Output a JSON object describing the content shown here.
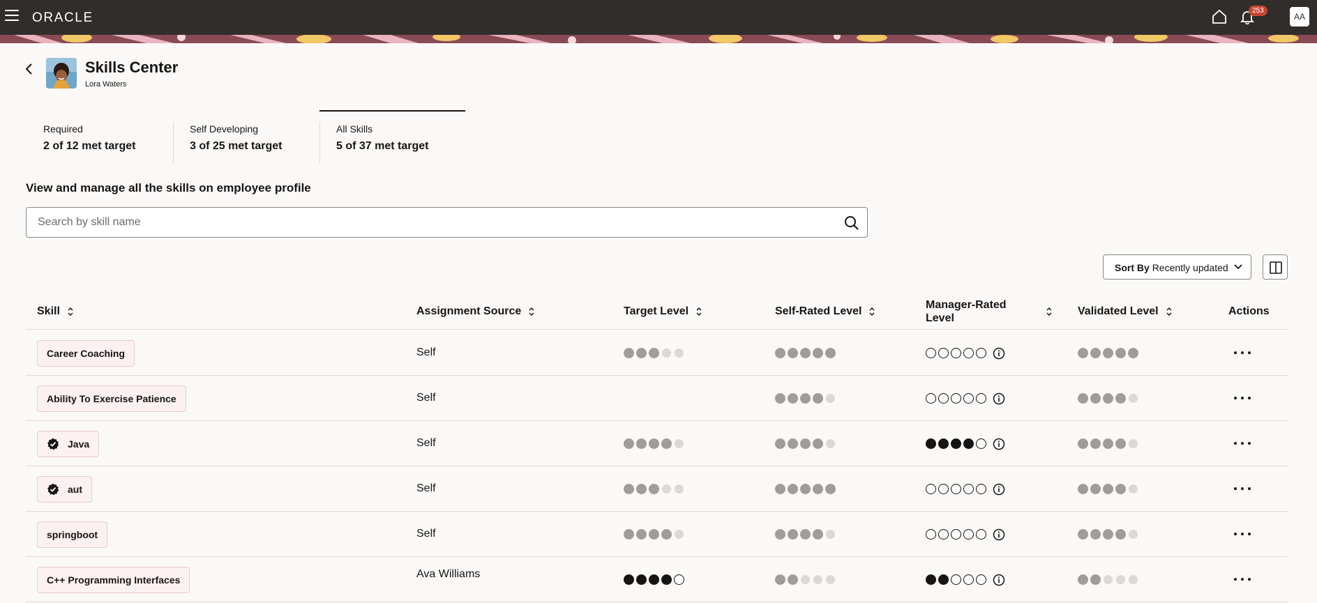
{
  "app": {
    "brand": "ORACLE",
    "notification_count": "253",
    "user_initials": "AA",
    "icons": {
      "menu": "hamburger-icon",
      "home": "home-icon",
      "notifications": "bell-icon"
    }
  },
  "header": {
    "title": "Skills Center",
    "subtitle": "Lora Waters"
  },
  "tabs": [
    {
      "label": "Required",
      "value": "2 of 12 met target",
      "active": false
    },
    {
      "label": "Self Developing",
      "value": "3 of 25 met target",
      "active": false
    },
    {
      "label": "All Skills",
      "value": "5 of 37 met target",
      "active": true
    }
  ],
  "section_heading": "View and manage all the skills on employee profile",
  "search": {
    "placeholder": "Search by skill name",
    "value": ""
  },
  "sort": {
    "prefix": "Sort By",
    "value": "Recently updated"
  },
  "table": {
    "columns": {
      "skill": "Skill",
      "source": "Assignment Source",
      "target": "Target Level",
      "self": "Self-Rated Level",
      "manager": "Manager-Rated Level",
      "validated": "Validated Level",
      "actions": "Actions"
    },
    "rows": [
      {
        "skill": "Career Coaching",
        "verified": false,
        "source": "Self",
        "target": 3,
        "self": 5,
        "manager": 0,
        "validated": 5
      },
      {
        "skill": "Ability To Exercise Patience",
        "verified": false,
        "source": "Self",
        "target": null,
        "self": 4,
        "manager": 0,
        "validated": 4
      },
      {
        "skill": "Java",
        "verified": true,
        "source": "Self",
        "target": 4,
        "self": 4,
        "manager": 4,
        "validated": 4
      },
      {
        "skill": "aut",
        "verified": true,
        "source": "Self",
        "target": 3,
        "self": 5,
        "manager": 0,
        "validated": 4
      },
      {
        "skill": "springboot",
        "verified": false,
        "source": "Self",
        "target": 4,
        "self": 4,
        "manager": 0,
        "validated": 4
      },
      {
        "skill": "C++ Programming Interfaces",
        "verified": false,
        "source": "Ava Williams",
        "target": 4,
        "target_style": "dark",
        "self": 2,
        "manager": 2,
        "validated": 2
      }
    ],
    "max_level": 5
  },
  "colors": {
    "topbar": "#312d2a",
    "dot_filled_grey": "#a19c98",
    "dot_empty_grey": "#dcd8d4",
    "dot_dark": "#161513",
    "chip_bg": "#fbf1f2",
    "badge": "#c74634"
  }
}
